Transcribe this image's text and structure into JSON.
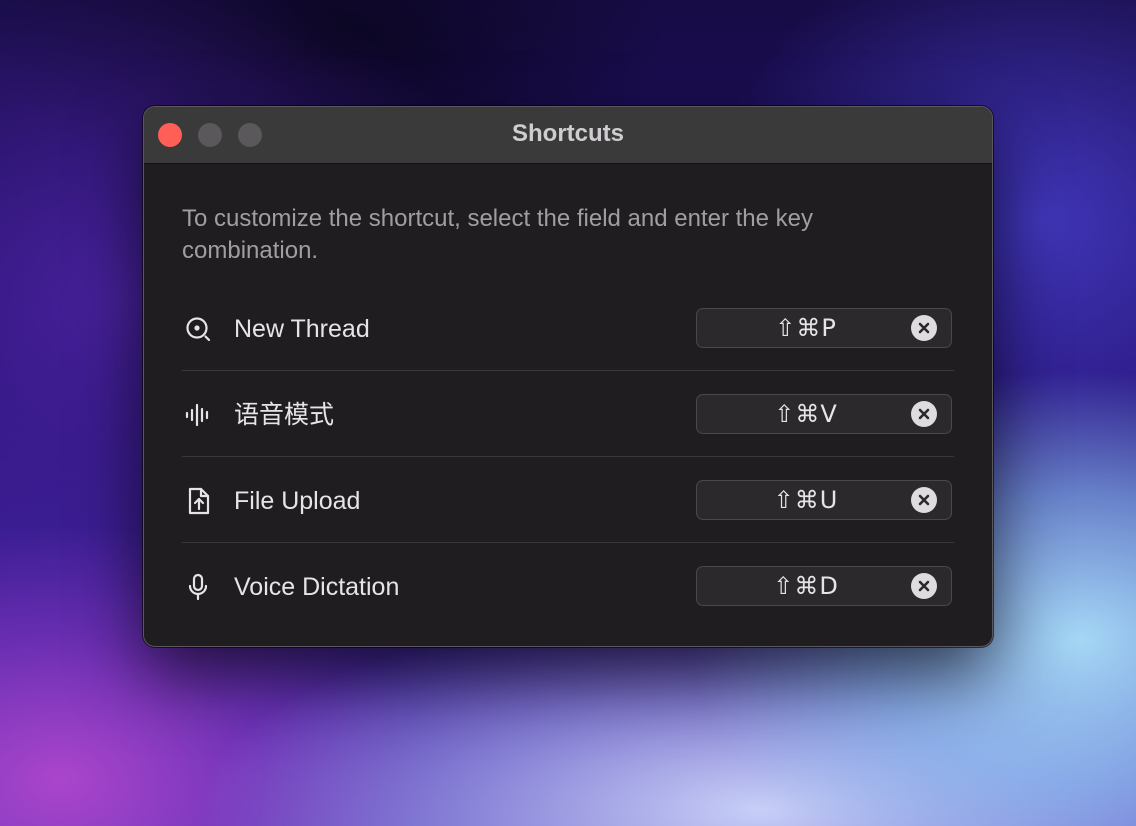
{
  "window": {
    "title": "Shortcuts",
    "controls": [
      "close",
      "minimize",
      "zoom"
    ]
  },
  "description": "To customize the shortcut, select the field and enter the key combination.",
  "shortcuts": [
    {
      "label": "New Thread",
      "icon": "search-circle-icon",
      "keys": "⇧⌘P"
    },
    {
      "label": "语音模式",
      "icon": "waveform-icon",
      "keys": "⇧⌘V"
    },
    {
      "label": "File Upload",
      "icon": "file-upload-icon",
      "keys": "⇧⌘U"
    },
    {
      "label": "Voice Dictation",
      "icon": "microphone-icon",
      "keys": "⇧⌘D"
    }
  ],
  "colors": {
    "close": "#ff5f57",
    "window_bg": "#1f1d1f",
    "titlebar_bg": "#3b3a3b",
    "field_bg": "#2b292c"
  }
}
